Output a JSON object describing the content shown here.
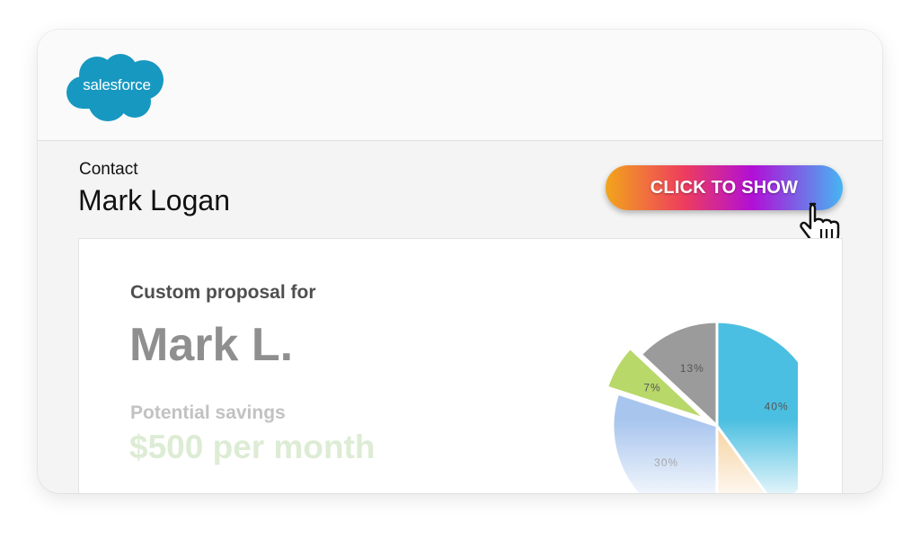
{
  "brand": {
    "logo_text": "salesforce",
    "color": "#1798c1"
  },
  "contact": {
    "label": "Contact",
    "name": "Mark Logan"
  },
  "action": {
    "label": "CLICK TO SHOW",
    "cursor_icon": "hand-pointer-icon"
  },
  "proposal": {
    "heading": "Custom proposal for",
    "recipient": "Mark L.",
    "savings_label": "Potential savings",
    "savings_value": "$500 per month"
  },
  "chart_data": {
    "type": "pie",
    "slices": [
      {
        "label": "40%",
        "value": 40,
        "color": "#4bbfe1"
      },
      {
        "label": "",
        "value": 10,
        "color": "#f6cf9a"
      },
      {
        "label": "30%",
        "value": 30,
        "color": "#a8c5ee"
      },
      {
        "label": "7%",
        "value": 7,
        "color": "#b8d86a"
      },
      {
        "label": "13%",
        "value": 13,
        "color": "#9b9b9b"
      }
    ]
  },
  "colors": {
    "button_gradient": [
      "#f2a51b",
      "#ee3d5e",
      "#b10fd7",
      "#46b5f3"
    ],
    "savings_value": "#ddecd4"
  }
}
